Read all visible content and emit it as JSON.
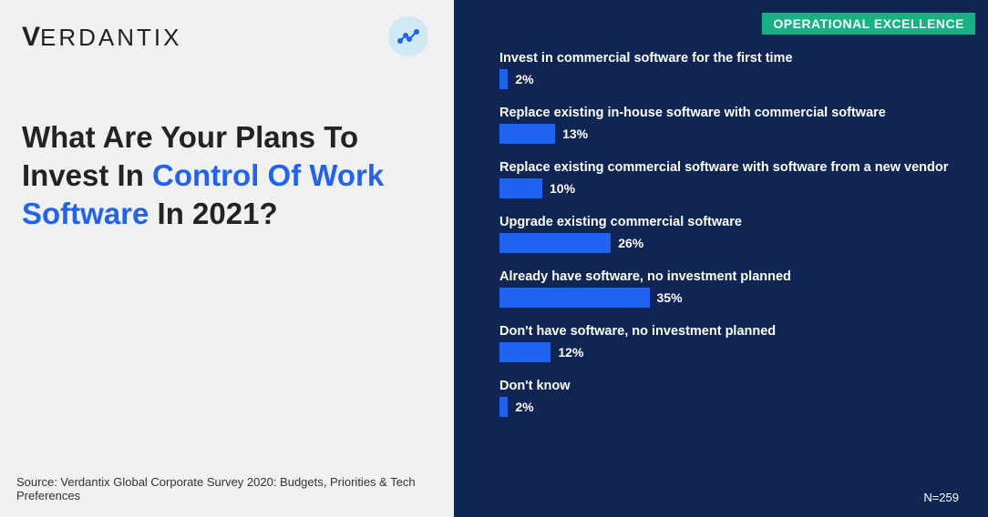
{
  "brand": "VERDANTIX",
  "badge": "OPERATIONAL EXCELLENCE",
  "title_parts": {
    "a": "What Are Your Plans To Invest In ",
    "b": "Control Of Work Software",
    "c": " In 2021?"
  },
  "source": "Source: Verdantix Global Corporate Survey 2020: Budgets, Priorities & Tech Preferences",
  "n_label": "N=259",
  "chart_data": {
    "type": "bar",
    "orientation": "horizontal",
    "title": "What Are Your Plans To Invest In Control Of Work Software In 2021?",
    "xlabel": "Percent",
    "xlim": [
      0,
      100
    ],
    "categories": [
      "Invest in commercial software for the first time",
      "Replace existing in-house software with commercial software",
      "Replace existing commercial software with software from a new vendor",
      "Upgrade existing commercial software",
      "Already have software, no investment planned",
      "Don't have software, no investment planned",
      "Don't know"
    ],
    "values": [
      2,
      13,
      10,
      26,
      35,
      12,
      2
    ],
    "value_labels": [
      "2%",
      "13%",
      "10%",
      "26%",
      "35%",
      "12%",
      "2%"
    ],
    "n": 259
  },
  "colors": {
    "accent": "#1f63f0",
    "badge": "#18b184",
    "panel_dark": "#0f2654"
  }
}
